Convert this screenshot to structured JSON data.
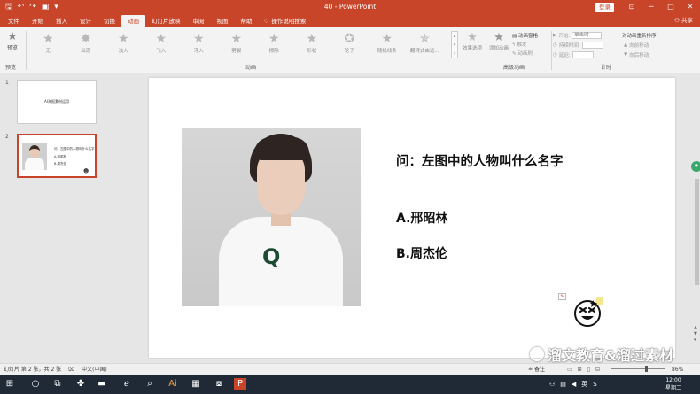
{
  "window": {
    "title": "40 - PowerPoint",
    "login": "登录",
    "share": "共享"
  },
  "tabs": [
    "文件",
    "开始",
    "插入",
    "设计",
    "切换",
    "动画",
    "幻灯片放映",
    "审阅",
    "视图",
    "帮助"
  ],
  "active_tab": "动画",
  "tell_me": "操作说明搜索",
  "ribbon": {
    "preview_label": "预览",
    "preview_group": "预览",
    "animation_group": "动画",
    "advanced_group": "高级动画",
    "timing_group": "计时",
    "gallery": [
      "无",
      "出现",
      "淡入",
      "飞入",
      "浮入",
      "劈裂",
      "擦除",
      "形状",
      "轮子",
      "随机线条",
      "翻转式由远..."
    ],
    "effect_options": "效果选项",
    "add_animation": "添加动画",
    "animation_pane": "动画窗格",
    "trigger": "触发",
    "animation_painter": "动画刷",
    "start_label": "开始:",
    "start_value": "单击时",
    "duration_label": "持续时间:",
    "delay_label": "延迟:",
    "reorder_label": "对动画重新排序",
    "move_earlier": "向前移动",
    "move_later": "向后移动"
  },
  "thumbnails": [
    {
      "number": "1",
      "title": "AI海报素材运用"
    },
    {
      "number": "2",
      "lines": [
        "问：左图中的人物叫什么名字",
        "A.邢昭林",
        "B.周杰伦"
      ]
    }
  ],
  "slide": {
    "question": "问：左图中的人物叫什么名字",
    "option_a": "A.邢昭林",
    "option_b": "B.周杰伦",
    "shirt_letter": "Q"
  },
  "watermark": "溜文教育&溜过素材",
  "status": {
    "slide_info": "幻灯片 第 2 张，共 2 张",
    "language": "中文(中国)",
    "notes": "备注",
    "zoom": "86%"
  },
  "clock": {
    "time": "12:00",
    "day": "星期二"
  },
  "ime": "英"
}
